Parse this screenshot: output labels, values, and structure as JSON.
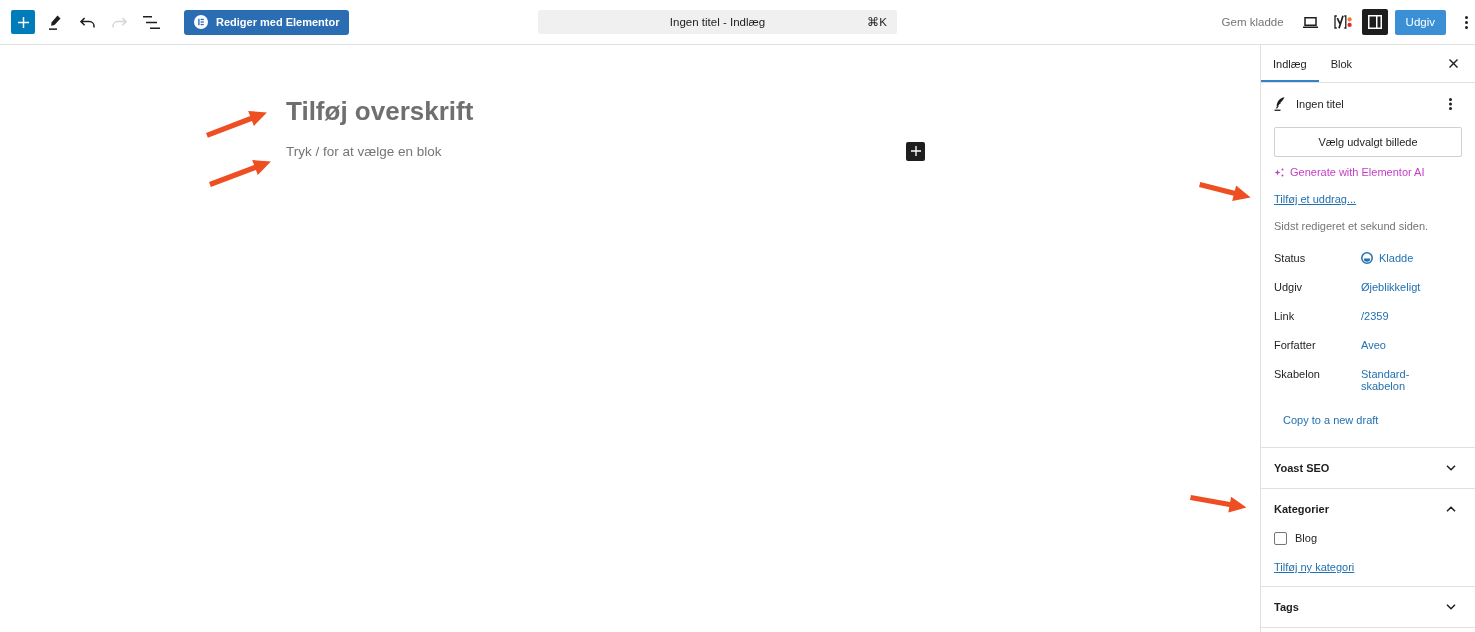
{
  "toolbar": {
    "tools": [
      {
        "kind": "inserter",
        "disabled": false
      },
      {
        "kind": "tools",
        "disabled": false
      },
      {
        "kind": "undo",
        "disabled": false
      },
      {
        "kind": "redo",
        "disabled": true
      },
      {
        "kind": "list_view",
        "disabled": false
      }
    ],
    "edit_button": "Rediger med Elementor",
    "command_bar": {
      "title": "Ingen titel - Indlæg",
      "shortcut": "⌘K"
    },
    "save_draft": "Gem kladde",
    "actions": [
      {
        "kind": "preview",
        "pressed": false
      },
      {
        "kind": "plugin",
        "pressed": false
      },
      {
        "kind": "settings",
        "pressed": true
      }
    ],
    "publish": "Udgiv"
  },
  "editor": {
    "title": {
      "placeholder": "Tilføj overskrift"
    },
    "paragraph": {
      "placeholder": "Tryk / for at vælge en blok"
    }
  },
  "sidebar": {
    "tabs": [
      {
        "label": "Indlæg",
        "selected": true
      },
      {
        "label": "Blok",
        "selected": false
      }
    ],
    "summary": {
      "title": "Ingen titel",
      "featured_image_button": "Vælg udvalgt billede",
      "ai_link": "Generate with Elementor AI",
      "excerpt_link": "Tilføj et uddrag...",
      "last_edited": "Sidst redigeret et sekund siden.",
      "fields": [
        {
          "label": "Status",
          "value": "Kladde",
          "kind": "status"
        },
        {
          "label": "Udgiv",
          "value": "Øjeblikkeligt",
          "kind": "plain"
        },
        {
          "label": "Link",
          "value": "/2359",
          "kind": "plain"
        },
        {
          "label": "Forfatter",
          "value": "Aveo",
          "kind": "plain"
        },
        {
          "label": "Skabelon",
          "value": "Standard-skabelon",
          "kind": "plain"
        }
      ],
      "copy_link": "Copy to a new draft"
    },
    "panels": [
      {
        "title": "Yoast SEO",
        "expanded": false
      },
      {
        "title": "Kategorier",
        "expanded": true,
        "categories": [
          {
            "label": "Blog",
            "checked": false
          }
        ],
        "add_link": "Tilføj ny kategori"
      },
      {
        "title": "Tags",
        "expanded": false
      }
    ]
  }
}
